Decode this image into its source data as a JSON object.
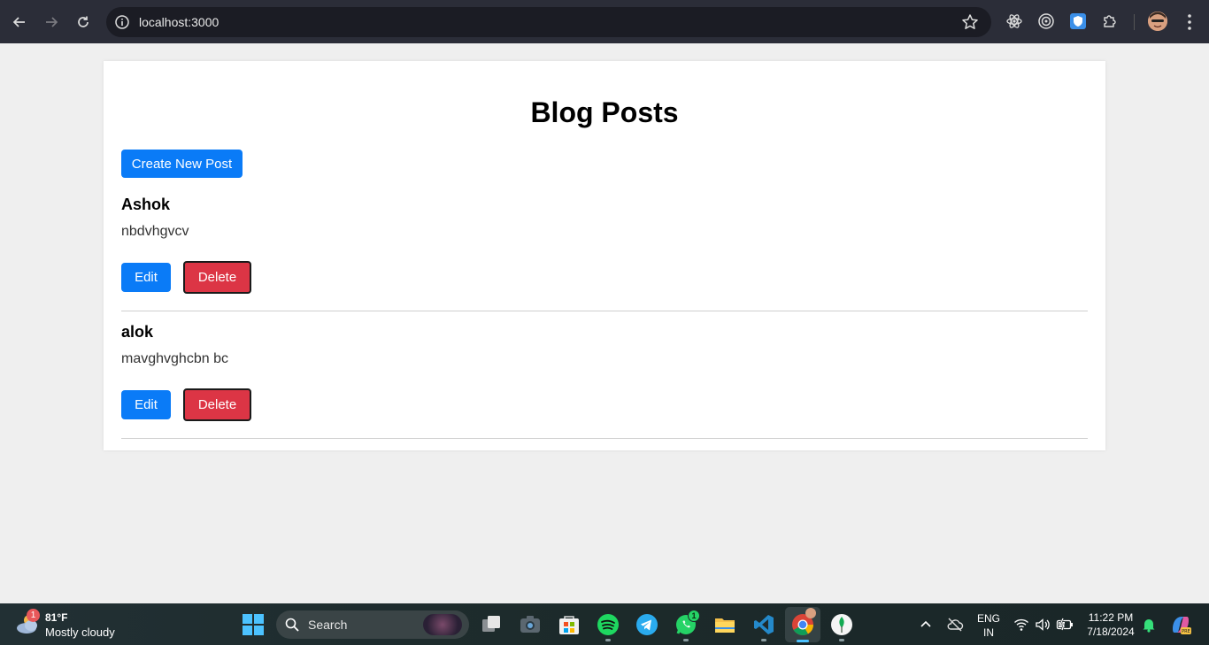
{
  "browser": {
    "url": "localhost:3000"
  },
  "page": {
    "title": "Blog Posts",
    "create_button_label": "Create New Post",
    "posts": [
      {
        "title": "Ashok",
        "body": "nbdvhgvcv",
        "edit_label": "Edit",
        "delete_label": "Delete"
      },
      {
        "title": "alok",
        "body": "mavghvghcbn bc",
        "edit_label": "Edit",
        "delete_label": "Delete"
      }
    ]
  },
  "taskbar": {
    "weather": {
      "temp": "81°F",
      "desc": "Mostly cloudy",
      "badge": "1"
    },
    "search_label": "Search",
    "whatsapp_badge": "1",
    "language": {
      "line1": "ENG",
      "line2": "IN"
    },
    "clock": {
      "time": "11:22 PM",
      "date": "7/18/2024"
    }
  },
  "colors": {
    "primary": "#0a7bf7",
    "danger": "#dc3545",
    "page_bg": "#efefef"
  }
}
